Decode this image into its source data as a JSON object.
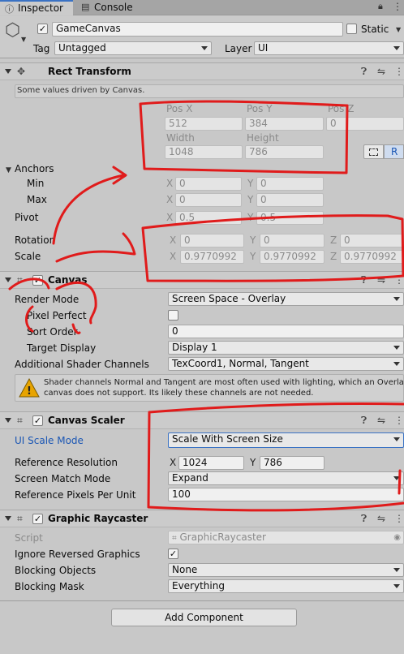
{
  "tabs": {
    "inspector": "Inspector",
    "console": "Console"
  },
  "header": {
    "object_name": "GameCanvas",
    "static_label": "Static",
    "tag_label": "Tag",
    "tag_value": "Untagged",
    "layer_label": "Layer",
    "layer_value": "UI"
  },
  "rect_transform": {
    "title": "Rect Transform",
    "info": "Some values driven by Canvas.",
    "pos_x_label": "Pos X",
    "pos_y_label": "Pos Y",
    "pos_z_label": "Pos Z",
    "pos_x": "512",
    "pos_y": "384",
    "pos_z": "0",
    "width_label": "Width",
    "height_label": "Height",
    "width": "1048",
    "height": "786",
    "r_button": "R",
    "anchors_label": "Anchors",
    "min_label": "Min",
    "max_label": "Max",
    "min_x": "0",
    "min_y": "0",
    "max_x": "0",
    "max_y": "0",
    "pivot_label": "Pivot",
    "pivot_x": "0.5",
    "pivot_y": "0.5",
    "rotation_label": "Rotation",
    "rot_x": "0",
    "rot_y": "0",
    "rot_z": "0",
    "scale_label": "Scale",
    "scale_x": "0.9770992",
    "scale_y": "0.9770992",
    "scale_z": "0.9770992",
    "axis_x": "X",
    "axis_y": "Y",
    "axis_z": "Z"
  },
  "canvas": {
    "title": "Canvas",
    "render_mode_label": "Render Mode",
    "render_mode": "Screen Space - Overlay",
    "pixel_perfect_label": "Pixel Perfect",
    "sort_order_label": "Sort Order",
    "sort_order": "0",
    "target_display_label": "Target Display",
    "target_display": "Display 1",
    "shader_channels_label": "Additional Shader Channels",
    "shader_channels": "TexCoord1, Normal, Tangent",
    "warning_line1": "Shader channels Normal and Tangent are most often used with lighting, which an Overlay",
    "warning_line2": "canvas does not support. Its likely these channels are not needed."
  },
  "canvas_scaler": {
    "title": "Canvas Scaler",
    "ui_scale_mode_label": "UI Scale Mode",
    "ui_scale_mode": "Scale With Screen Size",
    "reference_resolution_label": "Reference Resolution",
    "ref_x": "1024",
    "ref_y": "786",
    "screen_match_mode_label": "Screen Match Mode",
    "screen_match_mode": "Expand",
    "ref_ppu_label": "Reference Pixels Per Unit",
    "ref_ppu": "100"
  },
  "graphic_raycaster": {
    "title": "Graphic Raycaster",
    "script_label": "Script",
    "script_value": "GraphicRaycaster",
    "ignore_reversed_label": "Ignore Reversed Graphics",
    "blocking_objects_label": "Blocking Objects",
    "blocking_objects": "None",
    "blocking_mask_label": "Blocking Mask",
    "blocking_mask": "Everything"
  },
  "add_component": "Add Component",
  "annotation_color": "#e01b1b"
}
